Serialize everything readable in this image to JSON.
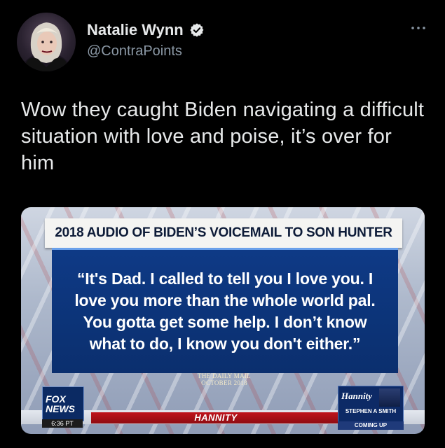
{
  "author": {
    "name": "Natalie Wynn",
    "handle": "@ContraPoints",
    "verified": true,
    "avatar_icon": "profile-photo"
  },
  "menu": {
    "icon": "more-horizontal-icon"
  },
  "tweet": {
    "text": "Wow they caught Biden navigating a difficult situation with love and poise, it’s over for him"
  },
  "media": {
    "headline": "2018 AUDIO OF BIDEN’S VOICEMAIL TO SON HUNTER",
    "quote": "“It's Dad. I called to tell you I love you. I love you more than the whole world pal. You gotta get some help. I don’t know what to do, I know you don't either.”",
    "source_line1": "THE DAILY MAIL",
    "source_line2": "OCTOBER 2018",
    "network_line1": "FOX",
    "network_line2": "NEWS",
    "time": "6:36 PT",
    "show_name": "HANNITY",
    "host_script": "Hannity",
    "guest_line1": "STEPHEN A SMITH",
    "guest_line2": "COMING UP"
  },
  "colors": {
    "background": "#000000",
    "text": "#e7e9ea",
    "secondary_text": "#8b98a5",
    "verified": "#e7e9ea",
    "chyron_blue": "#0e3a86",
    "fox_red": "#c0141c"
  }
}
